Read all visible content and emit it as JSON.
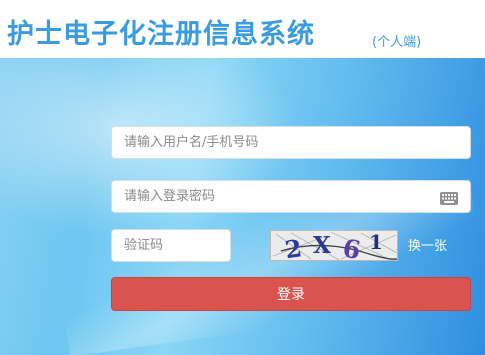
{
  "header": {
    "title": "护士电子化注册信息系统",
    "subtitle": "(个人端)"
  },
  "form": {
    "username_placeholder": "请输入用户名/手机号码",
    "password_placeholder": "请输入登录密码",
    "captcha_placeholder": "验证码",
    "captcha_text": "2X61",
    "refresh_label": "换一张",
    "login_label": "登录"
  },
  "icons": {
    "keyboard": "keyboard-icon"
  },
  "colors": {
    "title": "#3a9be0",
    "login_button": "#d9534f",
    "panel_dark": "#2f8ee0",
    "panel_light": "#8ad6f6"
  }
}
